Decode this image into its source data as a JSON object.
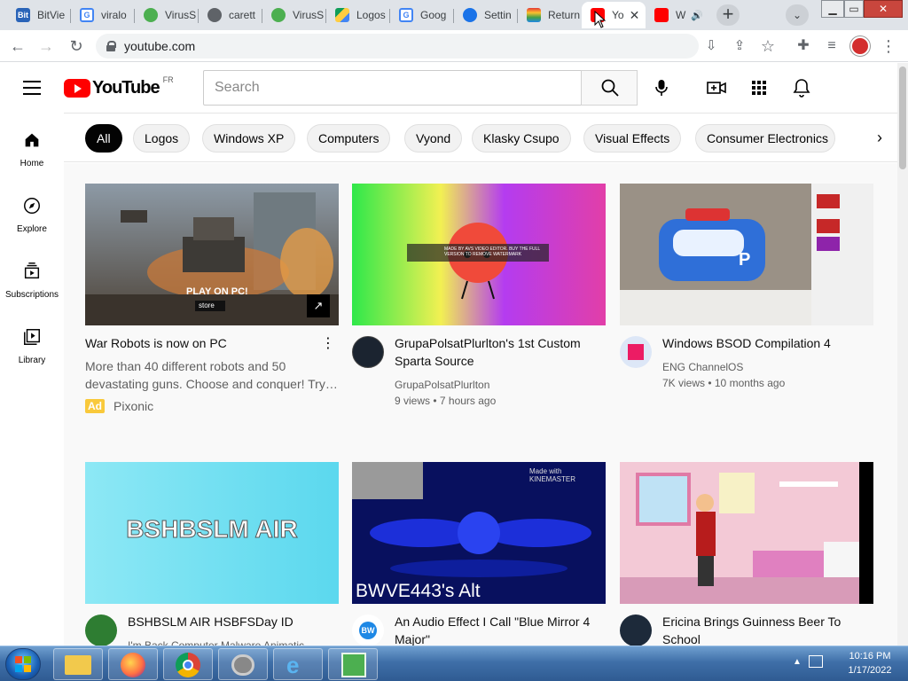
{
  "browser": {
    "tabs": [
      {
        "label": "BitVie",
        "favicon": "bitview-icon"
      },
      {
        "label": "viralo",
        "favicon": "google-icon"
      },
      {
        "label": "VirusS",
        "favicon": "virus-icon"
      },
      {
        "label": "carett",
        "favicon": "globe-icon"
      },
      {
        "label": "VirusS",
        "favicon": "virus-icon"
      },
      {
        "label": "Logos",
        "favicon": "google-drive-icon"
      },
      {
        "label": "Goog",
        "favicon": "google-icon"
      },
      {
        "label": "Settin",
        "favicon": "settings-icon"
      },
      {
        "label": "Return",
        "favicon": "rainbow-icon"
      },
      {
        "label": "Yo",
        "favicon": "youtube-icon",
        "active": true
      },
      {
        "label": "W",
        "favicon": "youtube-icon"
      }
    ],
    "url": "youtube.com"
  },
  "youtube": {
    "logo_text": "YouTube",
    "country_code": "FR",
    "search_placeholder": "Search",
    "chips": [
      "All",
      "Logos",
      "Windows XP",
      "Computers",
      "Vyond",
      "Klasky Csupo",
      "Visual Effects",
      "Consumer Electronics"
    ],
    "rail": [
      {
        "label": "Home",
        "icon": "home-icon"
      },
      {
        "label": "Explore",
        "icon": "compass-icon"
      },
      {
        "label": "Subscriptions",
        "icon": "subscriptions-icon"
      },
      {
        "label": "Library",
        "icon": "library-icon"
      }
    ],
    "videos": [
      {
        "title": "War Robots is now on PC",
        "description": "More than 40 different robots and 50 devastating guns. Choose and conquer! Try…",
        "ad_badge": "Ad",
        "channel": "Pixonic",
        "thumb_text": "PLAY ON PC!",
        "thumb_sub": "store"
      },
      {
        "title": "GrupaPolsatPlurlton's 1st Custom Sparta Source",
        "channel": "GrupaPolsatPlurlton",
        "stats": "9 views • 7 hours ago",
        "thumb_text": "MADE BY AVS VIDEO EDITOR. BUY THE FULL VERSION TO REMOVE WATERMARK"
      },
      {
        "title": "Windows BSOD Compilation 4",
        "channel": "ENG ChannelOS",
        "stats": "7K views • 10 months ago"
      },
      {
        "title": "BSHBSLM AIR HSBFSDay ID",
        "channel": "I'm Back Computer Malware Animatic",
        "thumb_text": "BSHBSLM AIR"
      },
      {
        "title": "An Audio Effect I Call \"Blue Mirror 4 Major\"",
        "thumb_text": "BWVE443's Alt",
        "thumb_badge": "Made with KINEMASTER"
      },
      {
        "title": "Ericina Brings Guinness Beer To School"
      }
    ]
  },
  "taskbar": {
    "time": "10:16 PM",
    "date": "1/17/2022"
  },
  "colors": {
    "youtube_red": "#ff0000",
    "chip_selected": "#030303",
    "ad_yellow": "#f9c93b",
    "taskbar_blue": "#3f6fa8"
  }
}
